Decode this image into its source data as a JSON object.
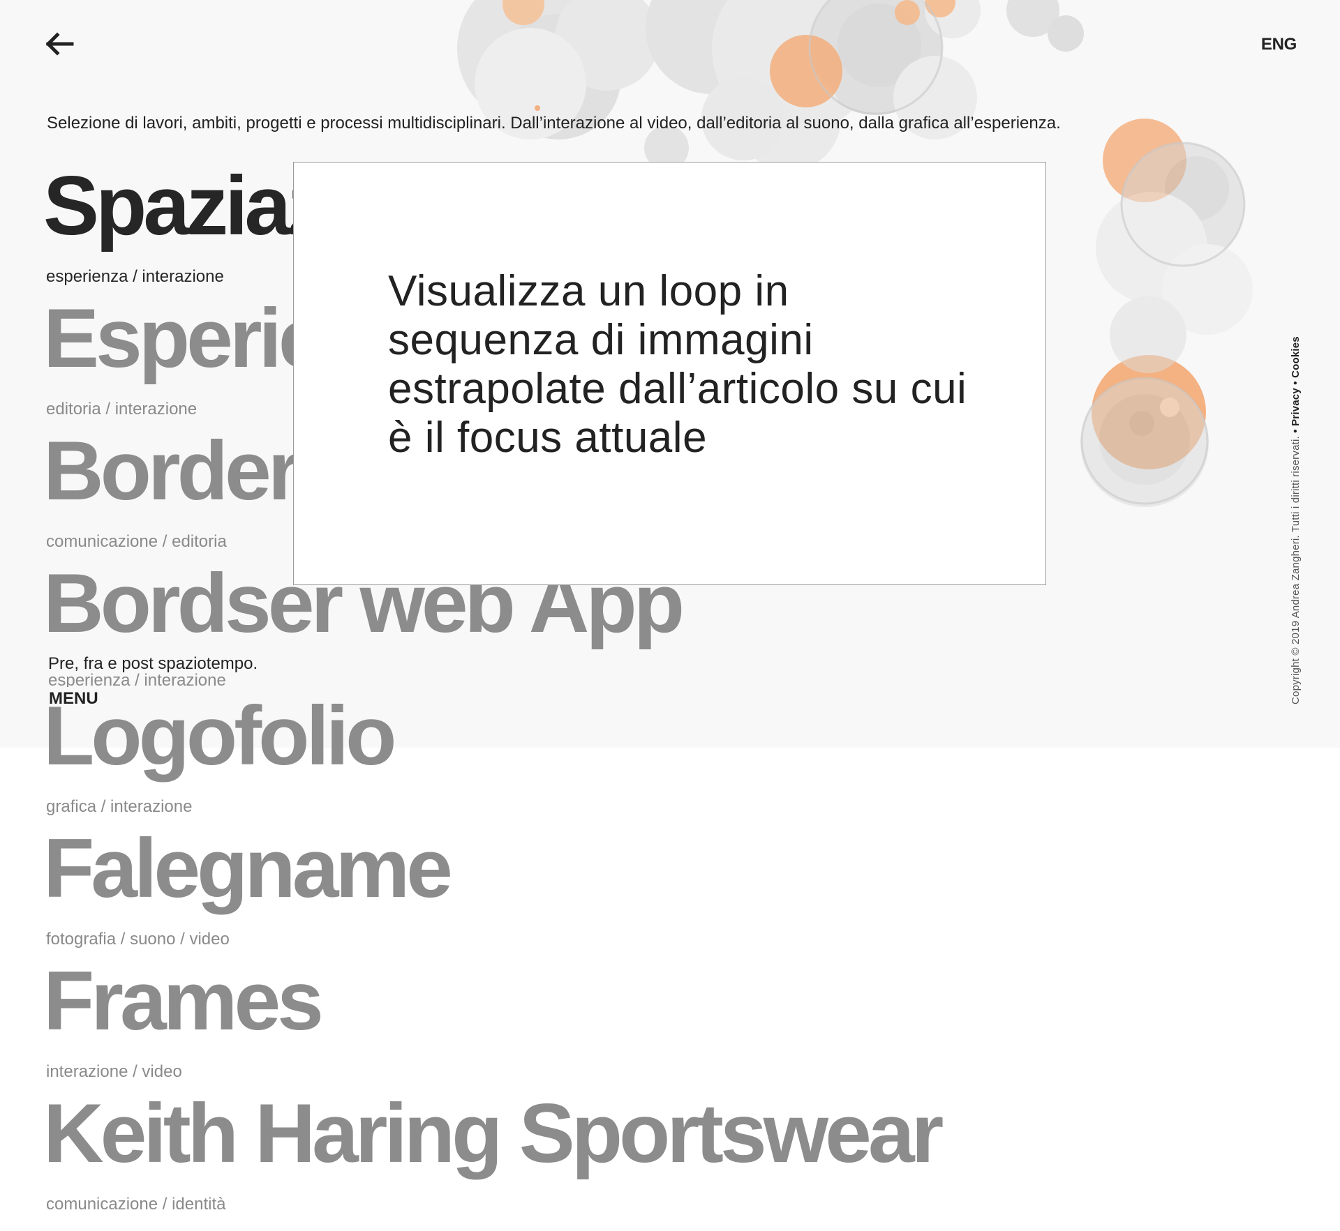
{
  "header": {
    "lang_label": "ENG",
    "intro": "Selezione di lavori, ambiti, progetti e processi multidisciplinari. Dall’interazione al video, dall’editoria al suono,  dalla grafica all’esperienza."
  },
  "projects": [
    {
      "title": "Spaziazioni",
      "tags": "esperienza / interazione"
    },
    {
      "title": "Esperienza",
      "tags": "editoria / interazione"
    },
    {
      "title": "Bordersphere",
      "tags": "comunicazione / editoria"
    },
    {
      "title": "Bordser web App",
      "tags": "esperienza / interazione"
    },
    {
      "title": "Logofolio",
      "tags": "grafica / interazione"
    },
    {
      "title": "Falegname",
      "tags": "fotografia / suono / video"
    },
    {
      "title": "Frames",
      "tags": "interazione / video"
    },
    {
      "title": "Keith Haring Sportswear",
      "tags": "comunicazione / identità"
    }
  ],
  "overlay": {
    "text": "Visualizza un loop in sequenza di immagini estrapolate dall’articolo su cui è il focus attuale"
  },
  "footer": {
    "tagline": "Pre, fra e post spaziotempo.",
    "menu_label": "MENU",
    "copyright": "Copyright © 2019 Andrea Zangheri. Tutti i diritti riservati.",
    "privacy_label": "• Privacy",
    "cookies_label": "• Cookies"
  },
  "colors": {
    "accent_orange": "#f4a46c",
    "bubble_gray": "#cfcfcf",
    "text_dark": "#262626",
    "text_muted": "#8c8c8c"
  },
  "icons": {
    "back": "arrow-left-icon"
  }
}
